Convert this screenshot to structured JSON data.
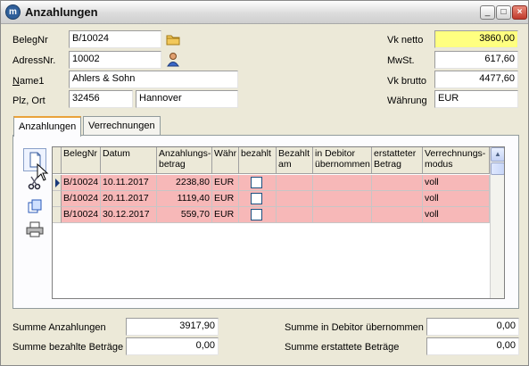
{
  "window": {
    "title": "Anzahlungen",
    "minimize": "_",
    "maximize": "□",
    "close": "×",
    "app_icon": "m"
  },
  "form": {
    "belegnr_label": "BelegNr",
    "belegnr_value": "B/10024",
    "adressnr_label": "AdressNr.",
    "adressnr_value": "10002",
    "name1_label": "Name1",
    "name1_value": "Ahlers & Sohn",
    "plzort_label": "Plz, Ort",
    "plz_value": "32456",
    "ort_value": "Hannover",
    "vknetto_label": "Vk netto",
    "vknetto_value": "3860,00",
    "mwst_label": "MwSt.",
    "mwst_value": "617,60",
    "vkbrutto_label": "Vk brutto",
    "vkbrutto_value": "4477,60",
    "waehrung_label": "Währung",
    "waehrung_value": "EUR"
  },
  "tabs": {
    "anzahlungen": "Anzahlungen",
    "verrechnungen": "Verrechnungen"
  },
  "toolbar_icons": [
    "new-document-icon",
    "scissors-icon",
    "copy-icon",
    "print-icon"
  ],
  "table": {
    "headers": [
      "BelegNr",
      "Datum",
      "Anzahlungs-betrag",
      "Währ",
      "bezahlt",
      "Bezahlt am",
      "in Debitor übernommen",
      "erstatteter Betrag",
      "Verrechnungs-modus"
    ],
    "rows": [
      {
        "belegnr": "B/10024",
        "datum": "10.11.2017",
        "betrag": "2238,80",
        "waehr": "EUR",
        "bezahlt": false,
        "modus": "voll"
      },
      {
        "belegnr": "B/10024",
        "datum": "20.11.2017",
        "betrag": "1119,40",
        "waehr": "EUR",
        "bezahlt": false,
        "modus": "voll"
      },
      {
        "belegnr": "B/10024",
        "datum": "30.12.2017",
        "betrag": "559,70",
        "waehr": "EUR",
        "bezahlt": false,
        "modus": "voll"
      }
    ],
    "row_color": "#f7b8b8"
  },
  "sums": {
    "summe_anzahlungen_label": "Summe Anzahlungen",
    "summe_anzahlungen_value": "3917,90",
    "summe_bezahlte_label": "Summe bezahlte Beträge",
    "summe_bezahlte_value": "0,00",
    "summe_debitor_label": "Summe in Debitor übernommen",
    "summe_debitor_value": "0,00",
    "summe_erstattete_label": "Summe erstattete Beträge",
    "summe_erstattete_value": "0,00"
  }
}
